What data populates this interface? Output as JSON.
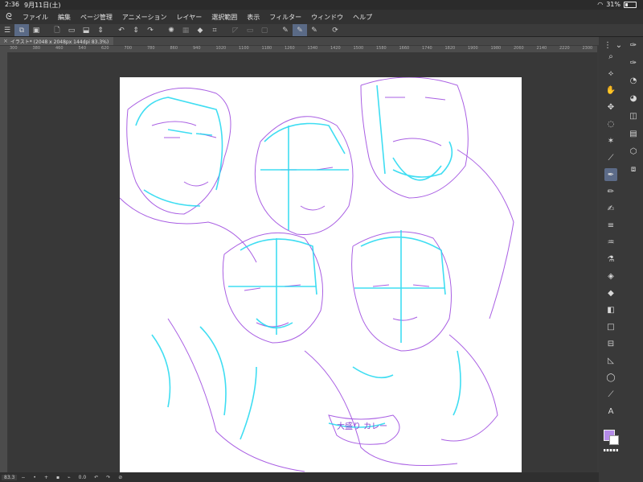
{
  "status": {
    "time": "2:36",
    "date": "9月11日(土)",
    "battery": "31%"
  },
  "menu": [
    "ファイル",
    "編集",
    "ページ管理",
    "アニメーション",
    "レイヤー",
    "選択範囲",
    "表示",
    "フィルター",
    "ウィンドウ",
    "ヘルプ"
  ],
  "tab": {
    "title": "イラスト* (2048 x 2048px 144dpi 83.3%)"
  },
  "ruler": [
    "300",
    "380",
    "460",
    "540",
    "620",
    "700",
    "780",
    "860",
    "940",
    "1020",
    "1100",
    "1180",
    "1260",
    "1340",
    "1420",
    "1500",
    "1580",
    "1660",
    "1740",
    "1820",
    "1900",
    "1980",
    "2060",
    "2140",
    "2220",
    "2300"
  ],
  "canvas_text": "大盛り カレー",
  "bottom": {
    "zoom": "83.3",
    "rotation": "0.0"
  },
  "colors": {
    "main": "#b48be8",
    "sub": "#ffffff",
    "accent": "#5c6b88"
  },
  "right_tools": [
    "search-icon",
    "navigator-icon",
    "hand-icon",
    "move-icon",
    "lasso-icon",
    "magic-wand-icon",
    "eyedropper-icon",
    "pen-icon",
    "pencil-icon",
    "brush-icon",
    "hatch-icon",
    "blend-icon",
    "airbrush-icon",
    "eraser-icon",
    "fill-icon",
    "gradient-icon",
    "rectangle-icon",
    "layer-icon",
    "ruler-icon",
    "balloon-icon",
    "pen-line-icon",
    "text-icon"
  ]
}
